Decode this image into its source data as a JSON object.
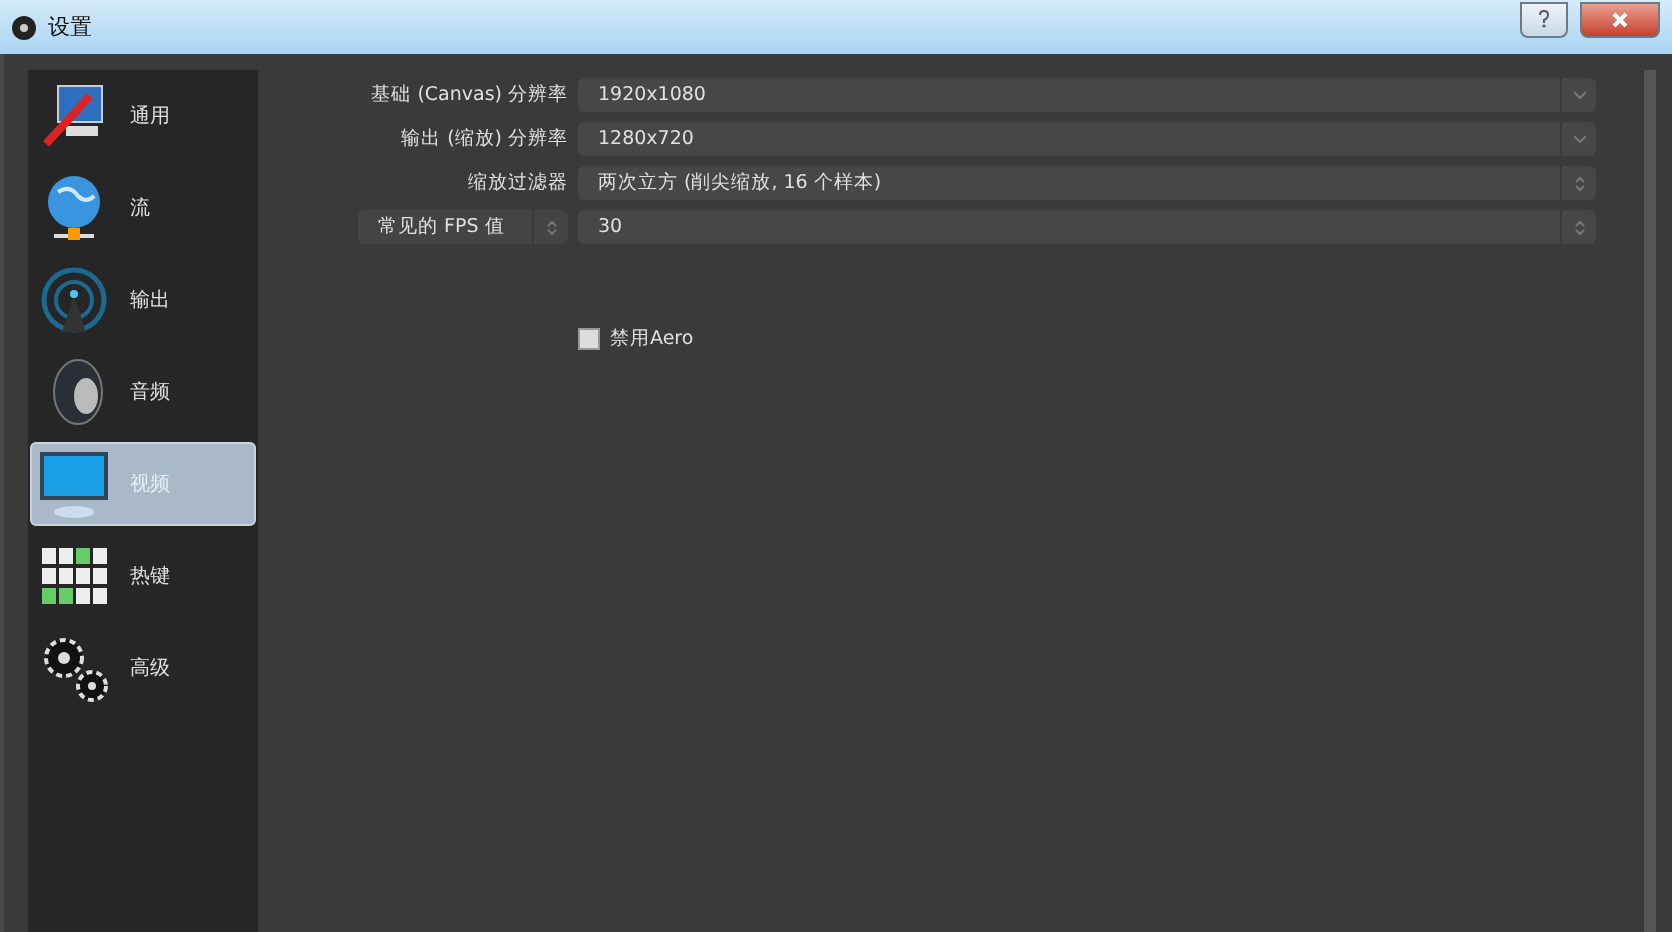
{
  "window": {
    "title": "设置"
  },
  "sidebar": {
    "items": [
      {
        "label": "通用",
        "kind": "general",
        "selected": false
      },
      {
        "label": "流",
        "kind": "stream",
        "selected": false
      },
      {
        "label": "输出",
        "kind": "output",
        "selected": false
      },
      {
        "label": "音频",
        "kind": "audio",
        "selected": false
      },
      {
        "label": "视频",
        "kind": "video",
        "selected": true
      },
      {
        "label": "热键",
        "kind": "hotkeys",
        "selected": false
      },
      {
        "label": "高级",
        "kind": "advanced",
        "selected": false
      }
    ]
  },
  "video": {
    "rows": [
      {
        "label": "基础 (Canvas) 分辨率",
        "label_spinbox": false,
        "value": "1920x1080",
        "kind": "dropdown"
      },
      {
        "label": "输出 (缩放) 分辨率",
        "label_spinbox": false,
        "value": "1280x720",
        "kind": "dropdown"
      },
      {
        "label": "缩放过滤器",
        "label_spinbox": false,
        "value": "两次立方 (削尖缩放, 16 个样本)",
        "kind": "spinner"
      },
      {
        "label": "常见的 FPS 值",
        "label_spinbox": true,
        "value": "30",
        "kind": "spinner"
      }
    ],
    "checkbox": {
      "label": "禁用Aero",
      "checked": false
    }
  }
}
